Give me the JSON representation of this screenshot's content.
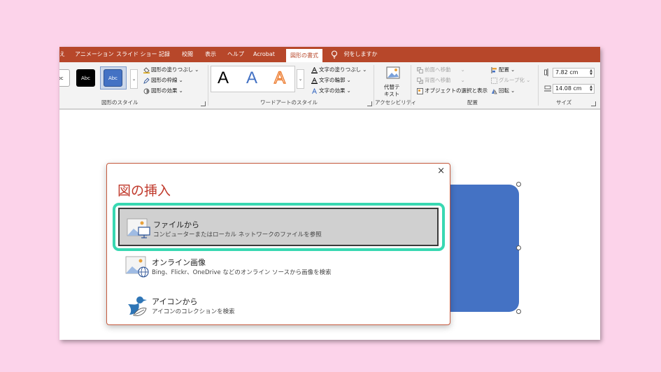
{
  "colors": {
    "background": "#fcd3ea",
    "tab_bar": "#b7472a",
    "shape": "#4472c4",
    "dialog_title": "#c0392b",
    "highlight": "#39d8b2"
  },
  "tabs": [
    {
      "label": "え"
    },
    {
      "label": "アニメーション"
    },
    {
      "label": "スライド ショー"
    },
    {
      "label": "記録"
    },
    {
      "label": "校閲"
    },
    {
      "label": "表示"
    },
    {
      "label": "ヘルプ"
    },
    {
      "label": "Acrobat"
    },
    {
      "label": "図形の書式",
      "active": true
    },
    {
      "label": "何をしますか",
      "icon": "lightbulb-icon"
    }
  ],
  "ribbon": {
    "shape_styles": {
      "swatches": [
        "bc",
        "Abc",
        "Abc"
      ],
      "fill": "図形の塗りつぶし",
      "outline": "図形の枠線",
      "effects": "図形の効果",
      "label": "図形のスタイル"
    },
    "wordart": {
      "letters": [
        "A",
        "A",
        "A"
      ],
      "text_fill": "文字の塗りつぶし",
      "text_outline": "文字の輪郭",
      "text_effects": "文字の効果",
      "label": "ワードアートのスタイル"
    },
    "accessibility": {
      "alt_text_line1": "代替テ",
      "alt_text_line2": "キスト",
      "label": "アクセシビリティ"
    },
    "arrange": {
      "bring_forward": "前面へ移動",
      "send_backward": "背面へ移動",
      "selection_pane": "オブジェクトの選択と表示",
      "align": "配置",
      "group": "グループ化",
      "rotate": "回転",
      "label": "配置"
    },
    "size": {
      "height": "7.82 cm",
      "width": "14.08 cm",
      "label": "サイズ"
    }
  },
  "dialog": {
    "title": "図の挿入",
    "close": "×",
    "options": [
      {
        "title": "ファイルから",
        "desc": "コンピューターまたはローカル ネットワークのファイルを参照",
        "icon": "image-from-computer-icon"
      },
      {
        "title": "オンライン画像",
        "desc": "Bing、Flickr、OneDrive などのオンライン ソースから画像を検索",
        "icon": "online-image-icon"
      },
      {
        "title": "アイコンから",
        "desc": "アイコンのコレクションを検索",
        "icon": "icon-bird-icon"
      }
    ]
  }
}
